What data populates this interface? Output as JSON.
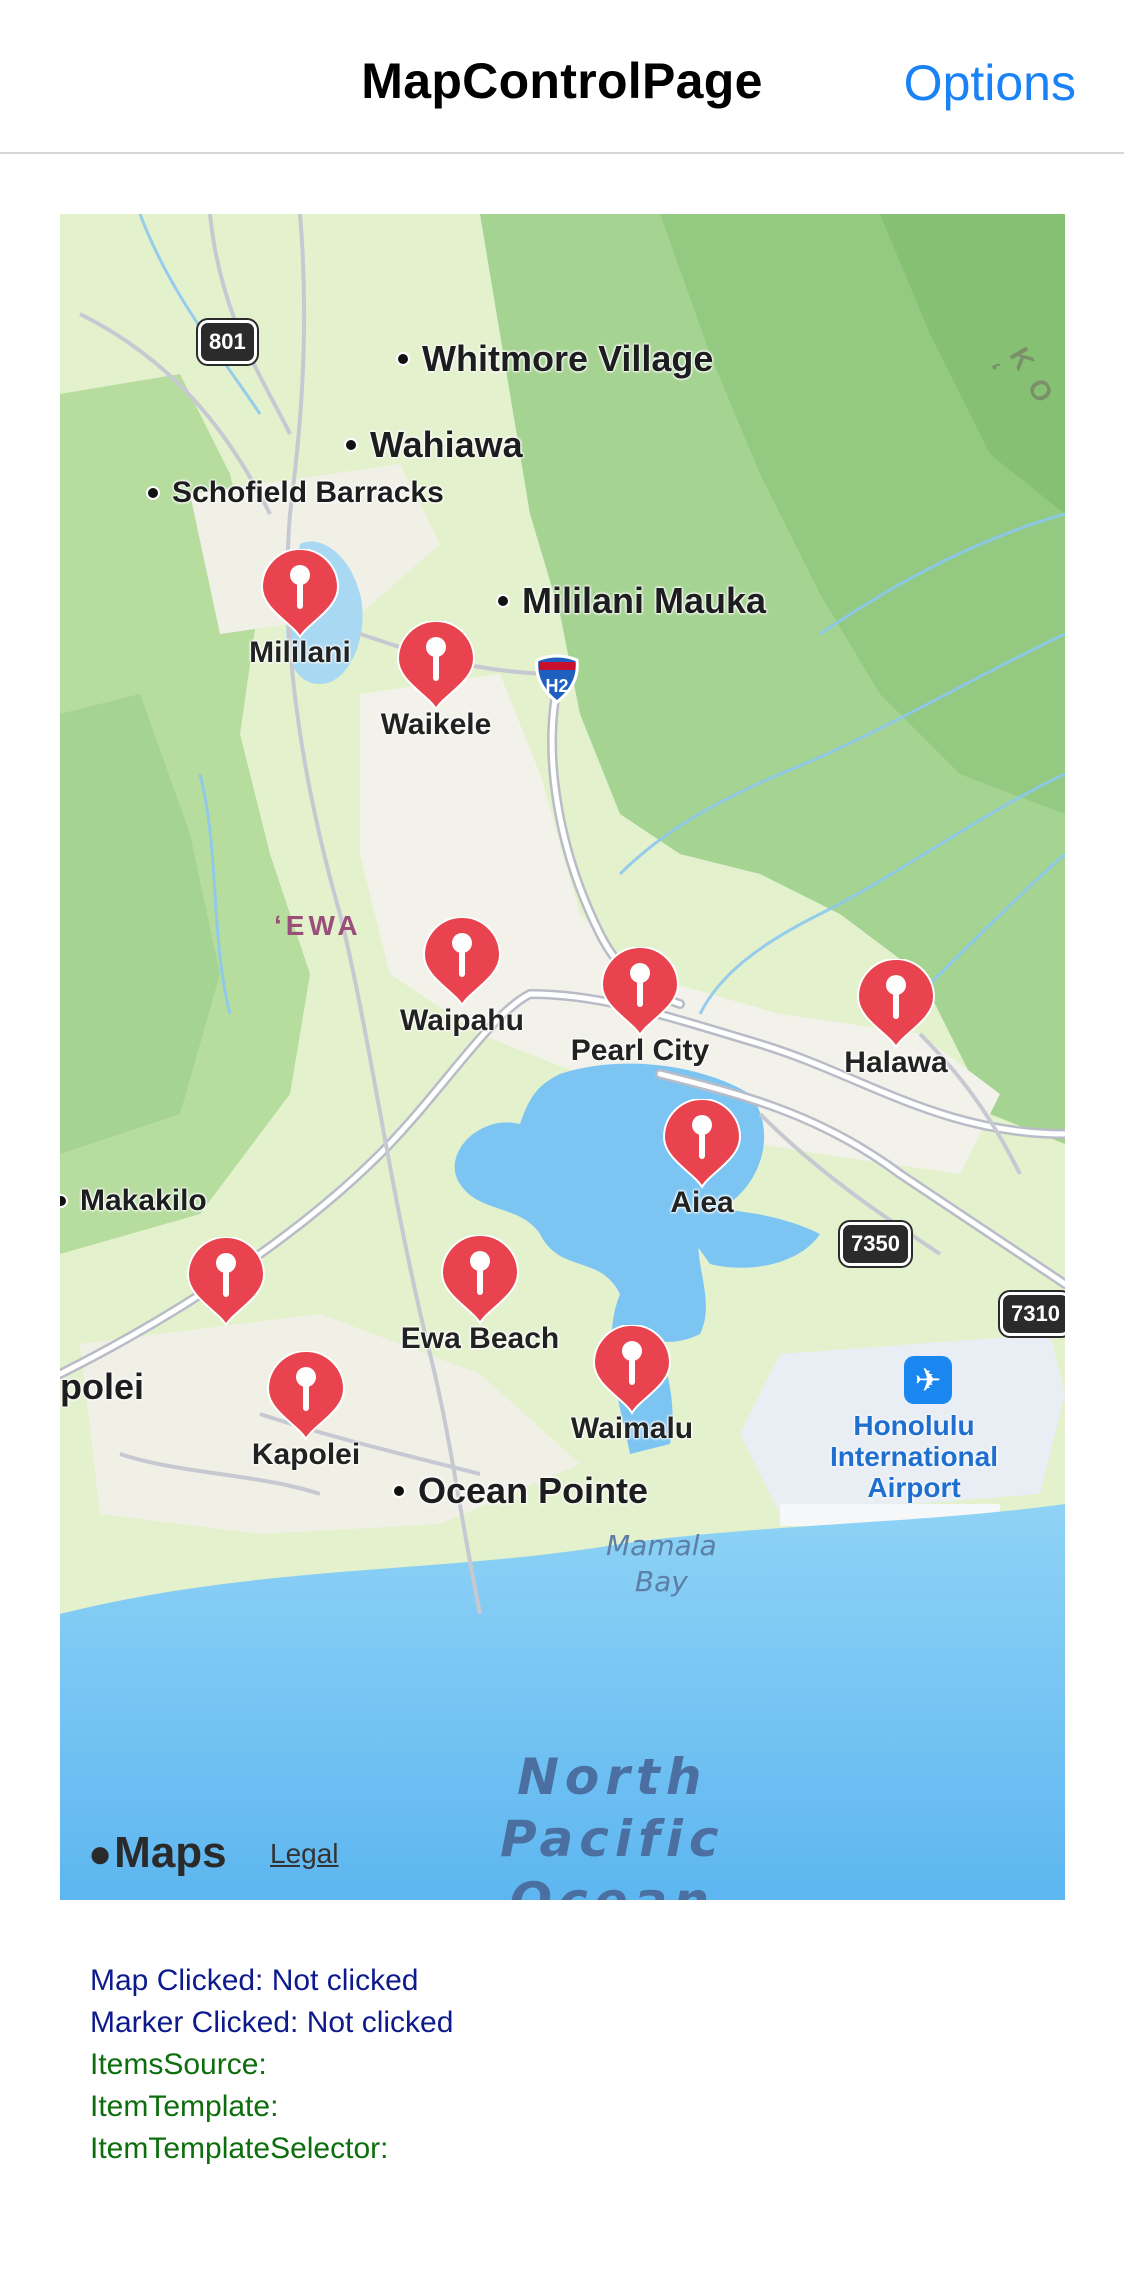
{
  "navbar": {
    "title": "MapControlPage",
    "options_label": "Options"
  },
  "map": {
    "places": {
      "whitmore": "Whitmore Village",
      "wahiawa": "Wahiawa",
      "schofield": "Schofield Barracks",
      "mililani_mauka": "Mililani Mauka",
      "makakilo": "Makakilo",
      "kapolei_city": "polei",
      "ocean_pointe": "Ocean Pointe",
      "ewa": "ʻEWA",
      "koo": "K O ʻ"
    },
    "shields": {
      "r801": "801",
      "h2": "H2",
      "r7350": "7350",
      "r7310": "7310"
    },
    "water": {
      "mamala": "Mamala\nBay",
      "north_pacific": "North\nPacific\nOcean"
    },
    "airport_label": "Honolulu\nInternational\nAirport",
    "markers": [
      {
        "label": "Mililani"
      },
      {
        "label": "Waikele"
      },
      {
        "label": "Waipahu"
      },
      {
        "label": "Pearl City"
      },
      {
        "label": "Halawa"
      },
      {
        "label": "Aiea"
      },
      {
        "label": "Ewa Beach"
      },
      {
        "label": "Waimalu"
      },
      {
        "label": "Kapolei"
      },
      {
        "label": ""
      }
    ],
    "attribution": {
      "maps_text": "Maps",
      "legal": "Legal"
    }
  },
  "status": {
    "map_clicked": "Map Clicked: Not clicked",
    "marker_clicked": "Marker Clicked: Not clicked",
    "items_source": "ItemsSource:",
    "item_template": "ItemTemplate:",
    "item_template_selector": "ItemTemplateSelector:"
  },
  "colors": {
    "accent": "#1a82f7",
    "pin_red": "#e8434f",
    "land": "#dcefc0",
    "forest": "#9fd08a",
    "water": "#74c1f2"
  }
}
